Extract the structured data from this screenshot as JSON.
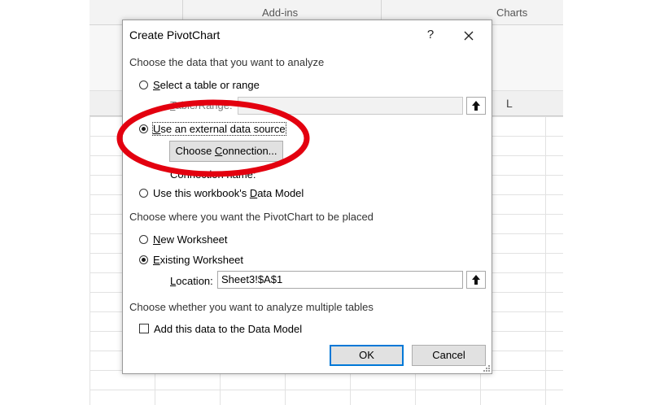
{
  "ribbon": {
    "groups": [
      "Add-ins",
      "Charts"
    ]
  },
  "columns": [
    "L"
  ],
  "dialog": {
    "title": "Create PivotChart",
    "help": "?",
    "close": "✕",
    "section1": "Choose the data that you want to analyze",
    "opt_table": {
      "prefix": "",
      "mnemonic": "S",
      "rest": "elect a table or range",
      "checked": false
    },
    "table_range": {
      "mnemonic": "T",
      "rest": "able/Range:",
      "value": ""
    },
    "opt_external": {
      "prefix": "",
      "mnemonic": "U",
      "rest": "se an external data source",
      "checked": true
    },
    "choose_connection": {
      "prefix": "Choose ",
      "mnemonic": "C",
      "rest": "onnection..."
    },
    "connection_name": "Connection name:",
    "opt_model": {
      "prefix": "Use this workbook's ",
      "mnemonic": "D",
      "rest": "ata Model",
      "checked": false
    },
    "section2": "Choose where you want the PivotChart to be placed",
    "opt_new": {
      "prefix": "",
      "mnemonic": "N",
      "rest": "ew Worksheet",
      "checked": false
    },
    "opt_existing": {
      "prefix": "",
      "mnemonic": "E",
      "rest": "xisting Worksheet",
      "checked": true
    },
    "location": {
      "mnemonic": "L",
      "rest": "ocation:",
      "value": "Sheet3!$A$1"
    },
    "section3": "Choose whether you want to analyze multiple tables",
    "add_model": {
      "label": "Add this data to the Data Model",
      "checked": false
    },
    "ok": "OK",
    "cancel": "Cancel"
  },
  "colors": {
    "annotation": "#e3000f",
    "focus_border": "#0078d7"
  }
}
